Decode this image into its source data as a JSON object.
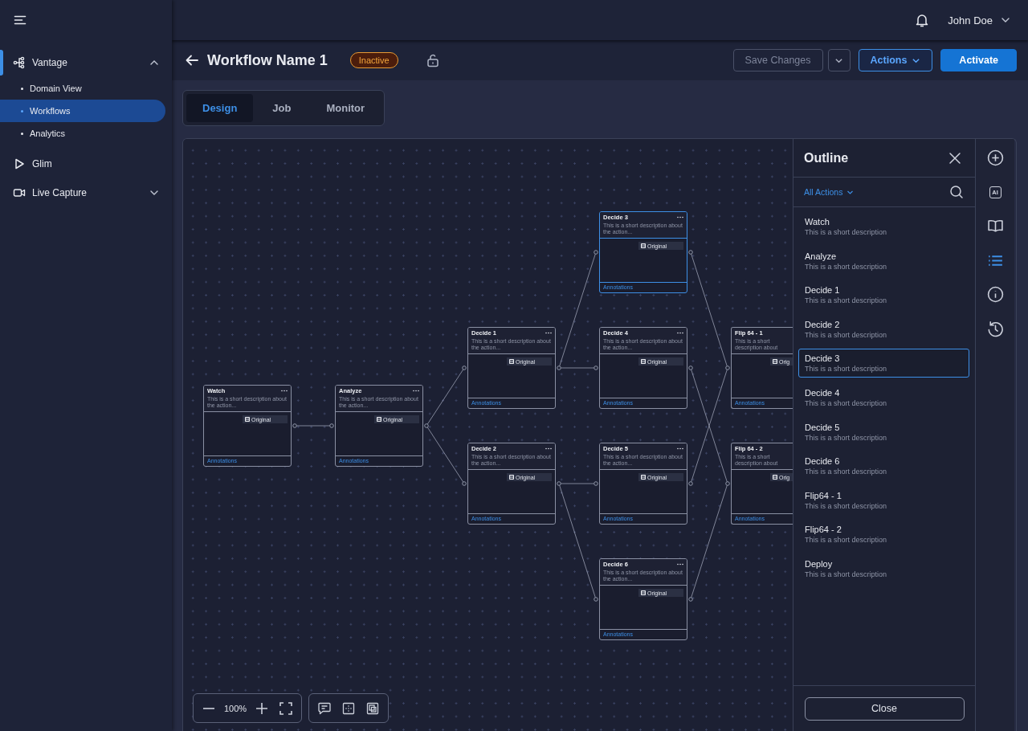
{
  "user": {
    "name": "John Doe"
  },
  "sidebar": {
    "items": [
      {
        "label": "Vantage",
        "selected": true,
        "expanded": true,
        "children": [
          {
            "label": "Domain View",
            "selected": false
          },
          {
            "label": "Workflows",
            "selected": true
          },
          {
            "label": "Analytics",
            "selected": false
          }
        ]
      },
      {
        "label": "Glim",
        "selected": false
      },
      {
        "label": "Live Capture",
        "selected": false,
        "expanded": false
      }
    ]
  },
  "header": {
    "title": "Workflow Name 1",
    "status": "Inactive",
    "buttons": [
      {
        "label": "Save Changes",
        "kind": "disabled"
      },
      {
        "kind": "caret"
      },
      {
        "label": "Actions",
        "kind": "outline"
      },
      {
        "label": "Activate",
        "kind": "primary"
      }
    ]
  },
  "tabs": [
    {
      "label": "Design",
      "selected": true
    },
    {
      "label": "Job",
      "selected": false
    },
    {
      "label": "Monitor",
      "selected": false
    }
  ],
  "nodes": [
    {
      "title": "Watch",
      "description": "This is a short description about the action...",
      "tag": "Original",
      "footer": "Annotations",
      "selected": false
    },
    {
      "title": "Analyze",
      "description": "This is a short description about the action...",
      "tag": "Original",
      "footer": "Annotations",
      "selected": false
    },
    {
      "title": "Decide 1",
      "description": "This is a short description about the action...",
      "tag": "Original",
      "footer": "Annotations",
      "selected": false
    },
    {
      "title": "Decide 2",
      "description": "This is a short description about the action...",
      "tag": "Original",
      "footer": "Annotations",
      "selected": false
    },
    {
      "title": "Decide 3",
      "description": "This is a short description about the action...",
      "tag": "Original",
      "footer": "Annotations",
      "selected": true
    },
    {
      "title": "Decide 4",
      "description": "This is a short description about the action...",
      "tag": "Original",
      "footer": "Annotations",
      "selected": false
    },
    {
      "title": "Decide 5",
      "description": "This is a short description about the action...",
      "tag": "Original",
      "footer": "Annotations",
      "selected": false
    },
    {
      "title": "Decide 6",
      "description": "This is a short description about the action...",
      "tag": "Original",
      "footer": "Annotations",
      "selected": false
    },
    {
      "title": "Flip 64 - 1",
      "description": "This is a short description about",
      "tag": "Orig",
      "footer": "Annotations",
      "selected": false
    },
    {
      "title": "Flip 64 - 2",
      "description": "This is a short description about",
      "tag": "Orig",
      "footer": "Annotations",
      "selected": false
    }
  ],
  "zoom": {
    "level_text": "100%"
  },
  "outline": {
    "title": "Outline",
    "filter": "All Actions",
    "items": [
      {
        "name": "Watch",
        "description": "This is a short description",
        "selected": false
      },
      {
        "name": "Analyze",
        "description": "This is a short description",
        "selected": false
      },
      {
        "name": "Decide 1",
        "description": "This is a short description",
        "selected": false
      },
      {
        "name": "Decide 2",
        "description": "This is a short description",
        "selected": false
      },
      {
        "name": "Decide 3",
        "description": "This is a short description",
        "selected": true
      },
      {
        "name": "Decide 4",
        "description": "This is a short description",
        "selected": false
      },
      {
        "name": "Decide 5",
        "description": "This is a short description",
        "selected": false
      },
      {
        "name": "Decide 6",
        "description": "This is a short description",
        "selected": false
      },
      {
        "name": "Flip64 - 1",
        "description": "This is a short description",
        "selected": false
      },
      {
        "name": "Flip64 - 2",
        "description": "This is a short description",
        "selected": false
      },
      {
        "name": "Deploy",
        "description": "This is a short description",
        "selected": false
      }
    ],
    "close": "Close"
  },
  "rail": [
    {
      "selected": false
    },
    {
      "selected": false,
      "label": "AI"
    },
    {
      "selected": false
    },
    {
      "selected": true
    },
    {
      "selected": false
    },
    {
      "selected": false
    }
  ]
}
